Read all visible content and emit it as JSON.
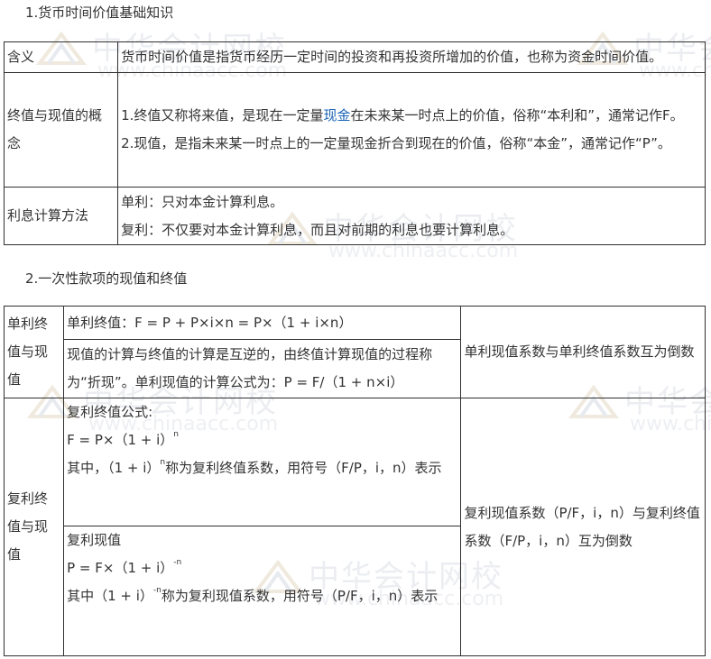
{
  "section1": {
    "heading": "1.货币时间价值基础知识",
    "rows": [
      {
        "label": "含义",
        "content": [
          "货币时间价值是指货币经历一定时间的投资和再投资所增加的价值，也称为资金时间价值。"
        ]
      },
      {
        "label": "终值与现值的概念",
        "content_parts": {
          "a_before": "1.终值又称将来值，是现在一定量",
          "a_link": "现金",
          "a_after": "在未来某一时点上的价值，俗称“本利和”，通常记作F。",
          "b": "2.现值，是指未来某一时点上的一定量现金折合到现在的价值，俗称“本金”，通常记作“P”。"
        }
      },
      {
        "label": "利息计算方法",
        "content": [
          "单利：只对本金计算利息。",
          "复利：不仅要对本金计算利息，而且对前期的利息也要计算利息。"
        ]
      }
    ]
  },
  "section2": {
    "heading": "2.一次性款项的现值和终值",
    "simple": {
      "label": "单利终值与现值",
      "fv_formula": "单利终值：F = P + P×i×n = P×（1 + i×n）",
      "pv_text": "现值的计算与终值的计算是互逆的，由终值计算现值的过程称为“折现”。单利现值的计算公式为：P = F/（1 + n×i）",
      "note": "单利现值系数与单利终值系数互为倒数"
    },
    "compound": {
      "label": "复利终值与现值",
      "fv_title": "复利终值公式:",
      "fv_formula": "F = P×（1 + i）",
      "fv_exp": "n",
      "fv_desc_pre": "其中，（1 + i）",
      "fv_desc_exp": "n",
      "fv_desc_post": "称为复利终值系数，用符号（F/P，i，n）表示",
      "pv_title": "复利现值",
      "pv_formula": "P = F×（1 + i）",
      "pv_exp": "-n",
      "pv_desc_pre": "其中（1 + i）",
      "pv_desc_exp": "-n",
      "pv_desc_post": "称为复利现值系数，用符号（P/F，i，n）表示",
      "note": "复利现值系数（P/F，i，n）与复利终值系数（F/P，i，n）互为倒数"
    }
  },
  "watermark": {
    "cn": "中华会计网校",
    "en": "www.chinaacc.com"
  },
  "colors": {
    "link": "#1a63b5",
    "border": "#2f2f2f",
    "text": "#333333"
  }
}
